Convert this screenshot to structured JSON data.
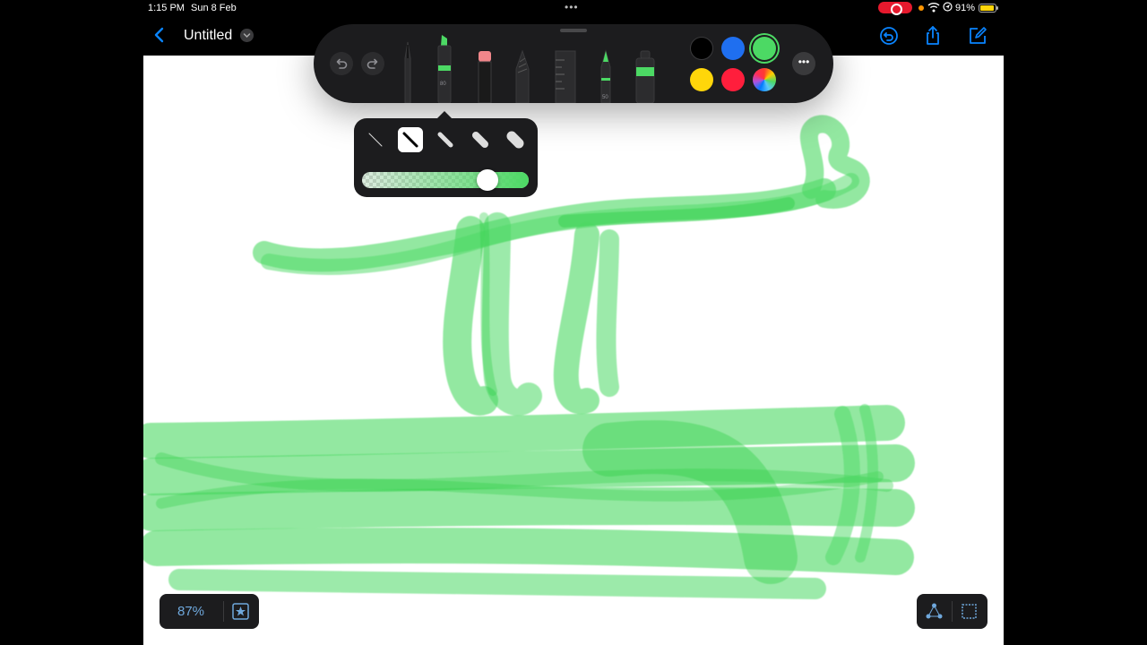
{
  "status_bar": {
    "time": "1:15 PM",
    "date": "Sun 8 Feb",
    "multitask_dots": "•••",
    "battery_percent": "91%"
  },
  "nav": {
    "title": "Untitled"
  },
  "toolbar": {
    "tools": [
      {
        "name": "pen",
        "width_label": ""
      },
      {
        "name": "marker",
        "width_label": "80"
      },
      {
        "name": "eraser",
        "width_label": ""
      },
      {
        "name": "pencil",
        "width_label": ""
      },
      {
        "name": "ruler",
        "width_label": ""
      },
      {
        "name": "fountain-pen",
        "width_label": "50"
      },
      {
        "name": "fill-bucket",
        "width_label": ""
      }
    ],
    "marker_label": "80",
    "fountain_label": "50",
    "colors": [
      {
        "hex": "#000000",
        "selected": false
      },
      {
        "hex": "#1f6ff0",
        "selected": false
      },
      {
        "hex": "#4cd964",
        "selected": true
      },
      {
        "hex": "#ffd60a",
        "selected": false
      },
      {
        "hex": "#ff1e3c",
        "selected": false
      },
      {
        "hex": "multicolor",
        "selected": false
      }
    ],
    "more_label": "•••"
  },
  "popover": {
    "width_options": 5,
    "selected_width_index": 1,
    "opacity": 0.75
  },
  "canvas": {
    "stroke_color": "#4cd964"
  },
  "zoom": {
    "label": "87%"
  }
}
